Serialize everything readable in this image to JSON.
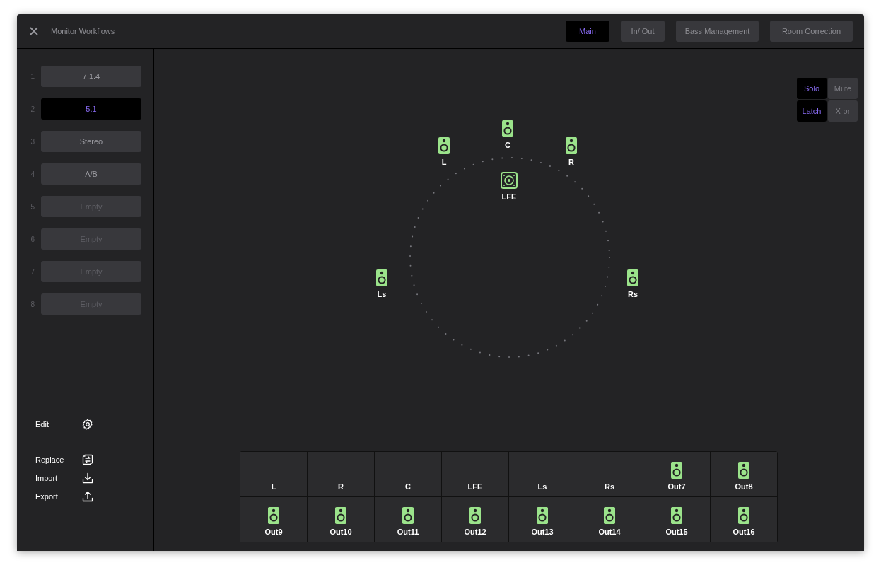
{
  "window": {
    "title": "Monitor Workflows"
  },
  "tabs": [
    {
      "label": "Main",
      "selected": true
    },
    {
      "label": "In/ Out",
      "selected": false
    },
    {
      "label": "Bass Management",
      "selected": false
    },
    {
      "label": "Room Correction",
      "selected": false
    }
  ],
  "presets": [
    {
      "number": "1",
      "label": "7.1.4",
      "selected": false,
      "empty": false
    },
    {
      "number": "2",
      "label": "5.1",
      "selected": true,
      "empty": false
    },
    {
      "number": "3",
      "label": "Stereo",
      "selected": false,
      "empty": false
    },
    {
      "number": "4",
      "label": "A/B",
      "selected": false,
      "empty": false
    },
    {
      "number": "5",
      "label": "Empty",
      "selected": false,
      "empty": true
    },
    {
      "number": "6",
      "label": "Empty",
      "selected": false,
      "empty": true
    },
    {
      "number": "7",
      "label": "Empty",
      "selected": false,
      "empty": true
    },
    {
      "number": "8",
      "label": "Empty",
      "selected": false,
      "empty": true
    }
  ],
  "edit_action": {
    "label": "Edit"
  },
  "file_actions": [
    {
      "label": "Replace",
      "kind": "replace"
    },
    {
      "label": "Import",
      "kind": "import"
    },
    {
      "label": "Export",
      "kind": "export"
    }
  ],
  "monitor_modes": [
    {
      "label": "Solo",
      "selected": true
    },
    {
      "label": "Mute",
      "selected": false
    },
    {
      "label": "Latch",
      "selected": true
    },
    {
      "label": "X-or",
      "selected": false
    }
  ],
  "speakers": [
    {
      "label": "C",
      "kind": "full_range"
    },
    {
      "label": "L",
      "kind": "full_range"
    },
    {
      "label": "R",
      "kind": "full_range"
    },
    {
      "label": "LFE",
      "kind": "subwoofer"
    },
    {
      "label": "Ls",
      "kind": "full_range"
    },
    {
      "label": "Rs",
      "kind": "full_range"
    }
  ],
  "outputs": [
    {
      "label": "L",
      "speaker": false
    },
    {
      "label": "R",
      "speaker": false
    },
    {
      "label": "C",
      "speaker": false
    },
    {
      "label": "LFE",
      "speaker": false
    },
    {
      "label": "Ls",
      "speaker": false
    },
    {
      "label": "Rs",
      "speaker": false
    },
    {
      "label": "Out7",
      "speaker": true
    },
    {
      "label": "Out8",
      "speaker": true
    },
    {
      "label": "Out9",
      "speaker": true
    },
    {
      "label": "Out10",
      "speaker": true
    },
    {
      "label": "Out11",
      "speaker": true
    },
    {
      "label": "Out12",
      "speaker": true
    },
    {
      "label": "Out13",
      "speaker": true
    },
    {
      "label": "Out14",
      "speaker": true
    },
    {
      "label": "Out15",
      "speaker": true
    },
    {
      "label": "Out16",
      "speaker": true
    }
  ]
}
